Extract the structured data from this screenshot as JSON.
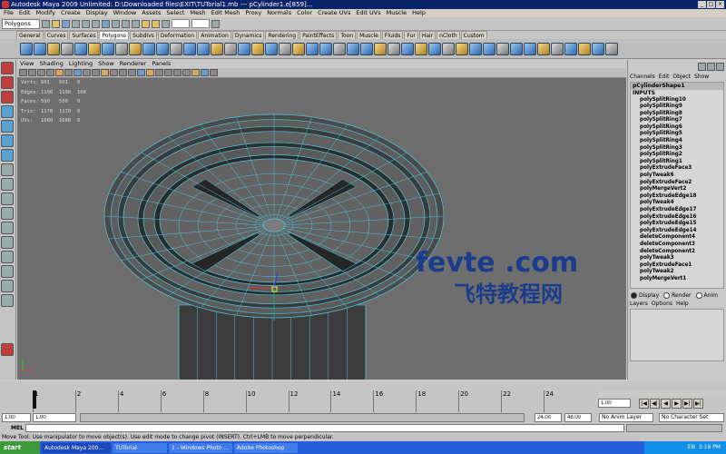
{
  "window": {
    "title": "Autodesk Maya 2009 Unlimited: D:\\Downloaded files\\EXIT\\TUTorial1.mb   ---   pCylinder1.e[859]..."
  },
  "menubar": [
    "File",
    "Edit",
    "Modify",
    "Create",
    "Display",
    "Window",
    "Assets",
    "Select",
    "Mesh",
    "Edit Mesh",
    "Proxy",
    "Normals",
    "Color",
    "Create UVs",
    "Edit UVs",
    "Muscle",
    "Help"
  ],
  "status_line": {
    "mode": "Polygons"
  },
  "shelf_tabs": [
    "General",
    "Curves",
    "Surfaces",
    "Polygons",
    "Subdivs",
    "Deformation",
    "Animation",
    "Dynamics",
    "Rendering",
    "PaintEffects",
    "Toon",
    "Muscle",
    "Fluids",
    "Fur",
    "Hair",
    "nCloth",
    "Custom"
  ],
  "shelf_active": "Polygons",
  "viewport_menu": [
    "View",
    "Shading",
    "Lighting",
    "Show",
    "Renderer",
    "Panels"
  ],
  "hud": {
    "rows": [
      {
        "label": "Verts:",
        "a": "601",
        "b": "601",
        "c": "0"
      },
      {
        "label": "Edges:",
        "a": "1190",
        "b": "1190",
        "c": "108"
      },
      {
        "label": "Faces:",
        "a": "590",
        "b": "590",
        "c": "0"
      },
      {
        "label": "Tris:",
        "a": "1170",
        "b": "1170",
        "c": "0"
      },
      {
        "label": "UVs:",
        "a": "1660",
        "b": "1660",
        "c": "0"
      }
    ]
  },
  "watermark": {
    "line1": "fevte .com",
    "line2": "飞特教程网"
  },
  "channel_box": {
    "menu": [
      "Channels",
      "Edit",
      "Object",
      "Show"
    ],
    "shape_name": "pCylinderShape1",
    "inputs_label": "INPUTS",
    "inputs": [
      "polySplitRing10",
      "polySplitRing9",
      "polySplitRing8",
      "polySplitRing7",
      "polySplitRing6",
      "polySplitRing5",
      "polySplitRing4",
      "polySplitRing3",
      "polySplitRing2",
      "polySplitRing1",
      "polyExtrudeFace3",
      "polyTweak6",
      "polyExtrudeFace2",
      "polyMergeVert2",
      "polyExtrudeEdge18",
      "polyTweak4",
      "polyExtrudeEdge17",
      "polyExtrudeEdge16",
      "polyExtrudeEdge15",
      "polyExtrudeEdge14",
      "deleteComponent4",
      "deleteComponent3",
      "deleteComponent2",
      "polyTweak3",
      "polyExtrudeFace1",
      "polyTweak2",
      "polyMergeVert1"
    ]
  },
  "layer_editor": {
    "radios": [
      {
        "label": "Display",
        "on": true
      },
      {
        "label": "Render",
        "on": false
      },
      {
        "label": "Anim",
        "on": false
      }
    ],
    "menu": [
      "Layers",
      "Options",
      "Help"
    ]
  },
  "timeline": {
    "ticks": [
      "1",
      "2",
      "4",
      "6",
      "8",
      "10",
      "12",
      "14",
      "16",
      "18",
      "20",
      "22",
      "24"
    ],
    "current_frame": "1.00"
  },
  "range": {
    "start": "1.00",
    "start2": "1.00",
    "end": "24.00",
    "end2": "48.00",
    "anim_layer": "No Anim Layer",
    "char_set": "No Character Set"
  },
  "playback_buttons": [
    "|◀",
    "◀|",
    "◀",
    "▶",
    "▶|",
    "▶|"
  ],
  "mel": {
    "label": "MEL"
  },
  "helpline": "Move Tool: Use manipulator to move object(s). Use edit mode to change pivot (INSERT). Ctrl+LMB to move perpendicular.",
  "taskbar": {
    "start": "start",
    "tasks": [
      "Autodesk Maya 200...",
      "TUTorial",
      "1 - Windows Photo ...",
      "Adobe Photoshop"
    ],
    "tray_lang": "EN",
    "time": "3:16 PM"
  }
}
